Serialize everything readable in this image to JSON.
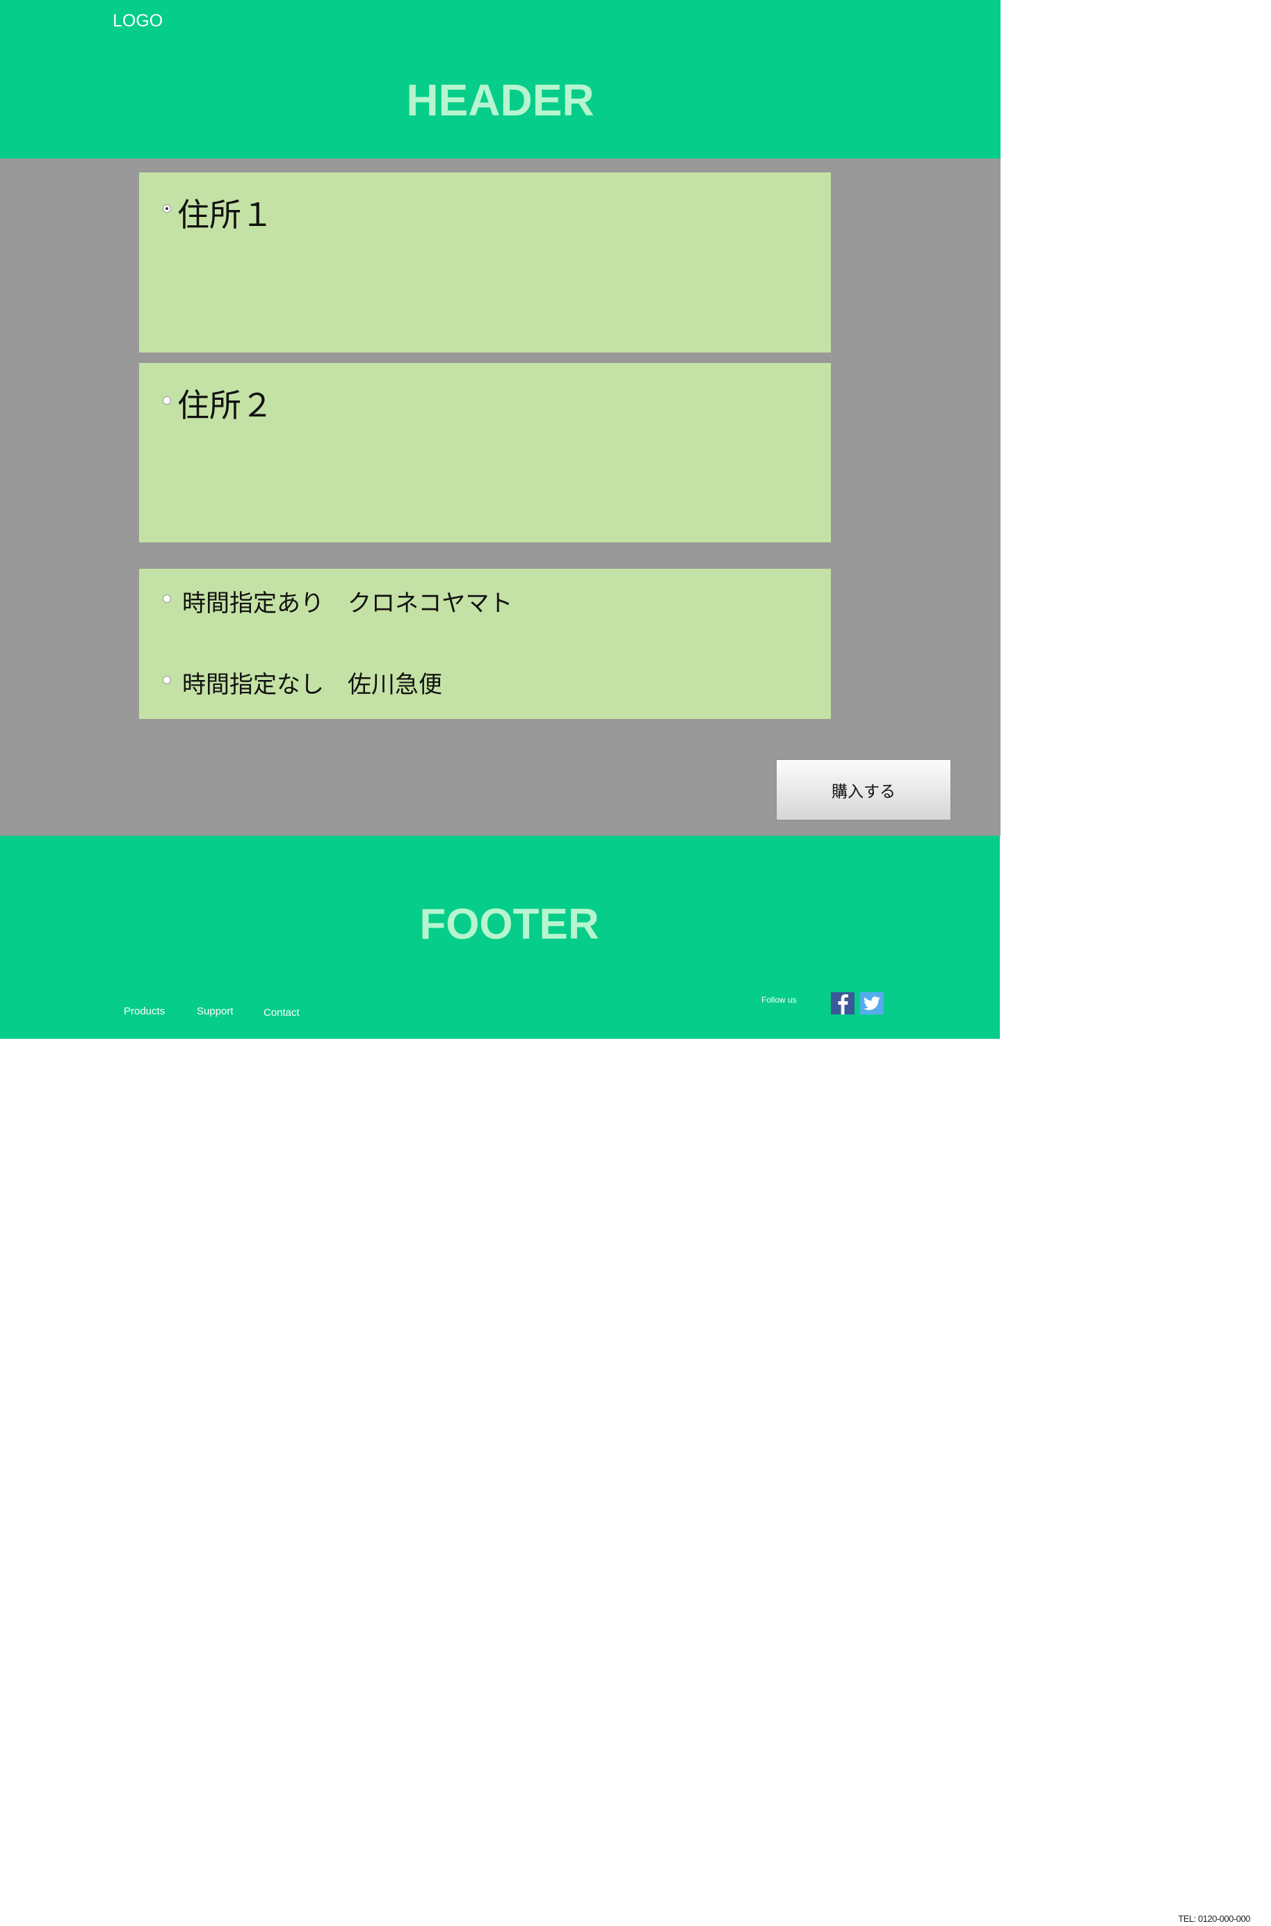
{
  "header": {
    "logo": "LOGO",
    "title": "HEADER"
  },
  "addresses": [
    {
      "label": "住所１",
      "selected": true
    },
    {
      "label": "住所２",
      "selected": false
    }
  ],
  "shipping_options": [
    {
      "label": "時間指定あり　クロネコヤマト",
      "selected": false
    },
    {
      "label": "時間指定なし　佐川急便",
      "selected": false
    }
  ],
  "buy_button": {
    "label": "購入する"
  },
  "footer": {
    "title": "FOOTER",
    "links": [
      "Products",
      "Support",
      "Contact"
    ],
    "follow_label": "Follow us",
    "social_icons": [
      "facebook-icon",
      "twitter-icon"
    ],
    "tel": "TEL: 0120-000-000"
  },
  "colors": {
    "brand_green": "#06cd89",
    "header_text": "#b6f5cf",
    "main_background": "#999999",
    "panel_background": "#c4e2a5",
    "facebook_blue": "#3b5998",
    "twitter_blue": "#55acee"
  }
}
